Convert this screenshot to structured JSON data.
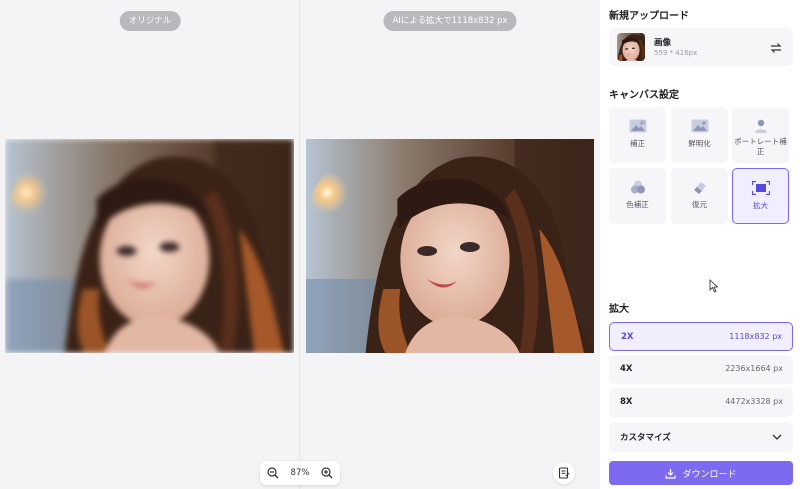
{
  "canvas": {
    "original_label": "オリジナル",
    "enlarged_label": "AIによる拡大で1118x832 px",
    "zoom": "87%"
  },
  "panel": {
    "new_upload_title": "新規アップロード",
    "file": {
      "name": "画像",
      "size": "559 * 416px"
    },
    "canvas_settings_title": "キャンバス設定",
    "tools": [
      {
        "label": "補正",
        "icon": "image-ai-icon"
      },
      {
        "label": "鮮明化",
        "icon": "image-icon"
      },
      {
        "label": "ポートレート補正",
        "icon": "portrait-icon"
      },
      {
        "label": "色補正",
        "icon": "color-circles-icon"
      },
      {
        "label": "復元",
        "icon": "eraser-icon"
      },
      {
        "label": "拡大",
        "icon": "upscale-icon",
        "active": true
      }
    ],
    "enlarge_title": "拡大",
    "scales": [
      {
        "label": "2X",
        "dims": "1118x832 px",
        "selected": true
      },
      {
        "label": "4X",
        "dims": "2236x1664 px"
      },
      {
        "label": "8X",
        "dims": "4472x3328 px"
      }
    ],
    "custom_label": "カスタマイズ",
    "download_label": "ダウンロード"
  },
  "colors": {
    "accent": "#7c6bf0",
    "accent_light": "#f1efff",
    "panel_bg": "#ffffff",
    "canvas_bg": "#f4f4f6"
  }
}
